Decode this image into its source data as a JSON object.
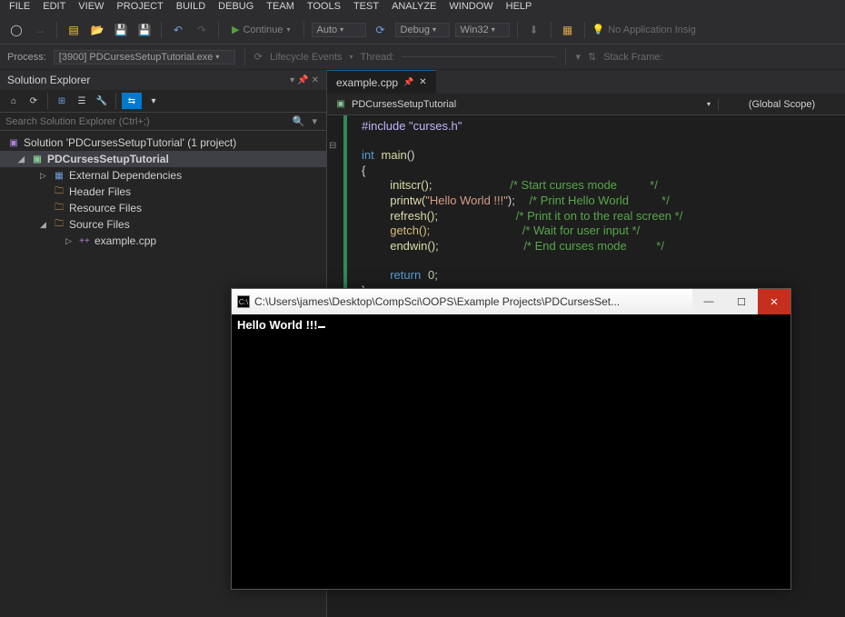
{
  "menubar": [
    "FILE",
    "EDIT",
    "VIEW",
    "PROJECT",
    "BUILD",
    "DEBUG",
    "TEAM",
    "TOOLS",
    "TEST",
    "ANALYZE",
    "WINDOW",
    "HELP"
  ],
  "toolbar": {
    "continue": "Continue",
    "config1": "Auto",
    "config2": "Debug",
    "config3": "Win32",
    "noAppInsight": "No Application Insig"
  },
  "toolbar2": {
    "processLabel": "Process:",
    "processValue": "[3900] PDCursesSetupTutorial.exe",
    "lifecycle": "Lifecycle Events",
    "thread": "Thread:",
    "stack": "Stack Frame:"
  },
  "solution": {
    "title": "Solution Explorer",
    "searchPlaceholder": "Search Solution Explorer (Ctrl+;)",
    "root": "Solution 'PDCursesSetupTutorial' (1 project)",
    "project": "PDCursesSetupTutorial",
    "items": [
      "External Dependencies",
      "Header Files",
      "Resource Files",
      "Source Files"
    ],
    "file": "example.cpp"
  },
  "editor": {
    "tab": "example.cpp",
    "navProject": "PDCursesSetupTutorial",
    "navScope": "(Global Scope)"
  },
  "code": {
    "include": "#include \"curses.h\"",
    "main_sig": "int main()",
    "l_brace": "{",
    "initscr": "initscr();",
    "initscr_c": "/* Start curses mode          */",
    "printw": "printw(",
    "printw_str": "\"Hello World !!!\"",
    "printw_end": ");",
    "printw_c": "/* Print Hello World          */",
    "refresh": "refresh();",
    "refresh_c": "/* Print it on to the real screen */",
    "getch": "getch();",
    "getch_c": "/* Wait for user input */",
    "endwin": "endwin();",
    "endwin_c": "/* End curses mode         */",
    "return": "return",
    "zero": "0",
    "semicolon": ";",
    "r_brace": "}"
  },
  "console": {
    "title": "C:\\Users\\james\\Desktop\\CompSci\\OOPS\\Example Projects\\PDCursesSet...",
    "output": "Hello World !!!"
  }
}
